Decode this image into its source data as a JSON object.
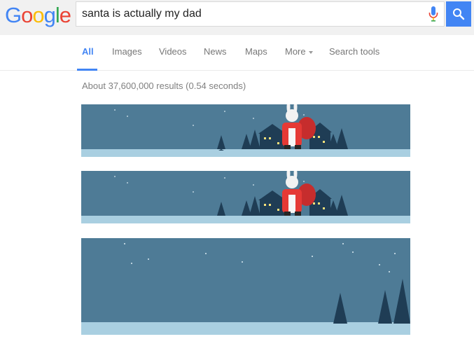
{
  "logo": {
    "letters": [
      "G",
      "o",
      "o",
      "g",
      "l",
      "e"
    ],
    "colors": [
      "#4285f4",
      "#ea4335",
      "#fbbc05",
      "#4285f4",
      "#34a853",
      "#ea4335"
    ]
  },
  "search": {
    "query": "santa is actually my dad"
  },
  "icons": {
    "mic": "microphone-icon",
    "search": "magnifier-icon",
    "more": "caret-down-icon"
  },
  "tabs": {
    "all": "All",
    "images": "Images",
    "videos": "Videos",
    "news": "News",
    "maps": "Maps",
    "more": "More",
    "tools": "Search tools"
  },
  "results": {
    "stats": "About 37,600,000 results (0.54 seconds)"
  },
  "colors": {
    "accent": "#4285f4",
    "sky": "#4e7b96",
    "snow": "#a9cfe1",
    "tree": "#1f3d55"
  }
}
